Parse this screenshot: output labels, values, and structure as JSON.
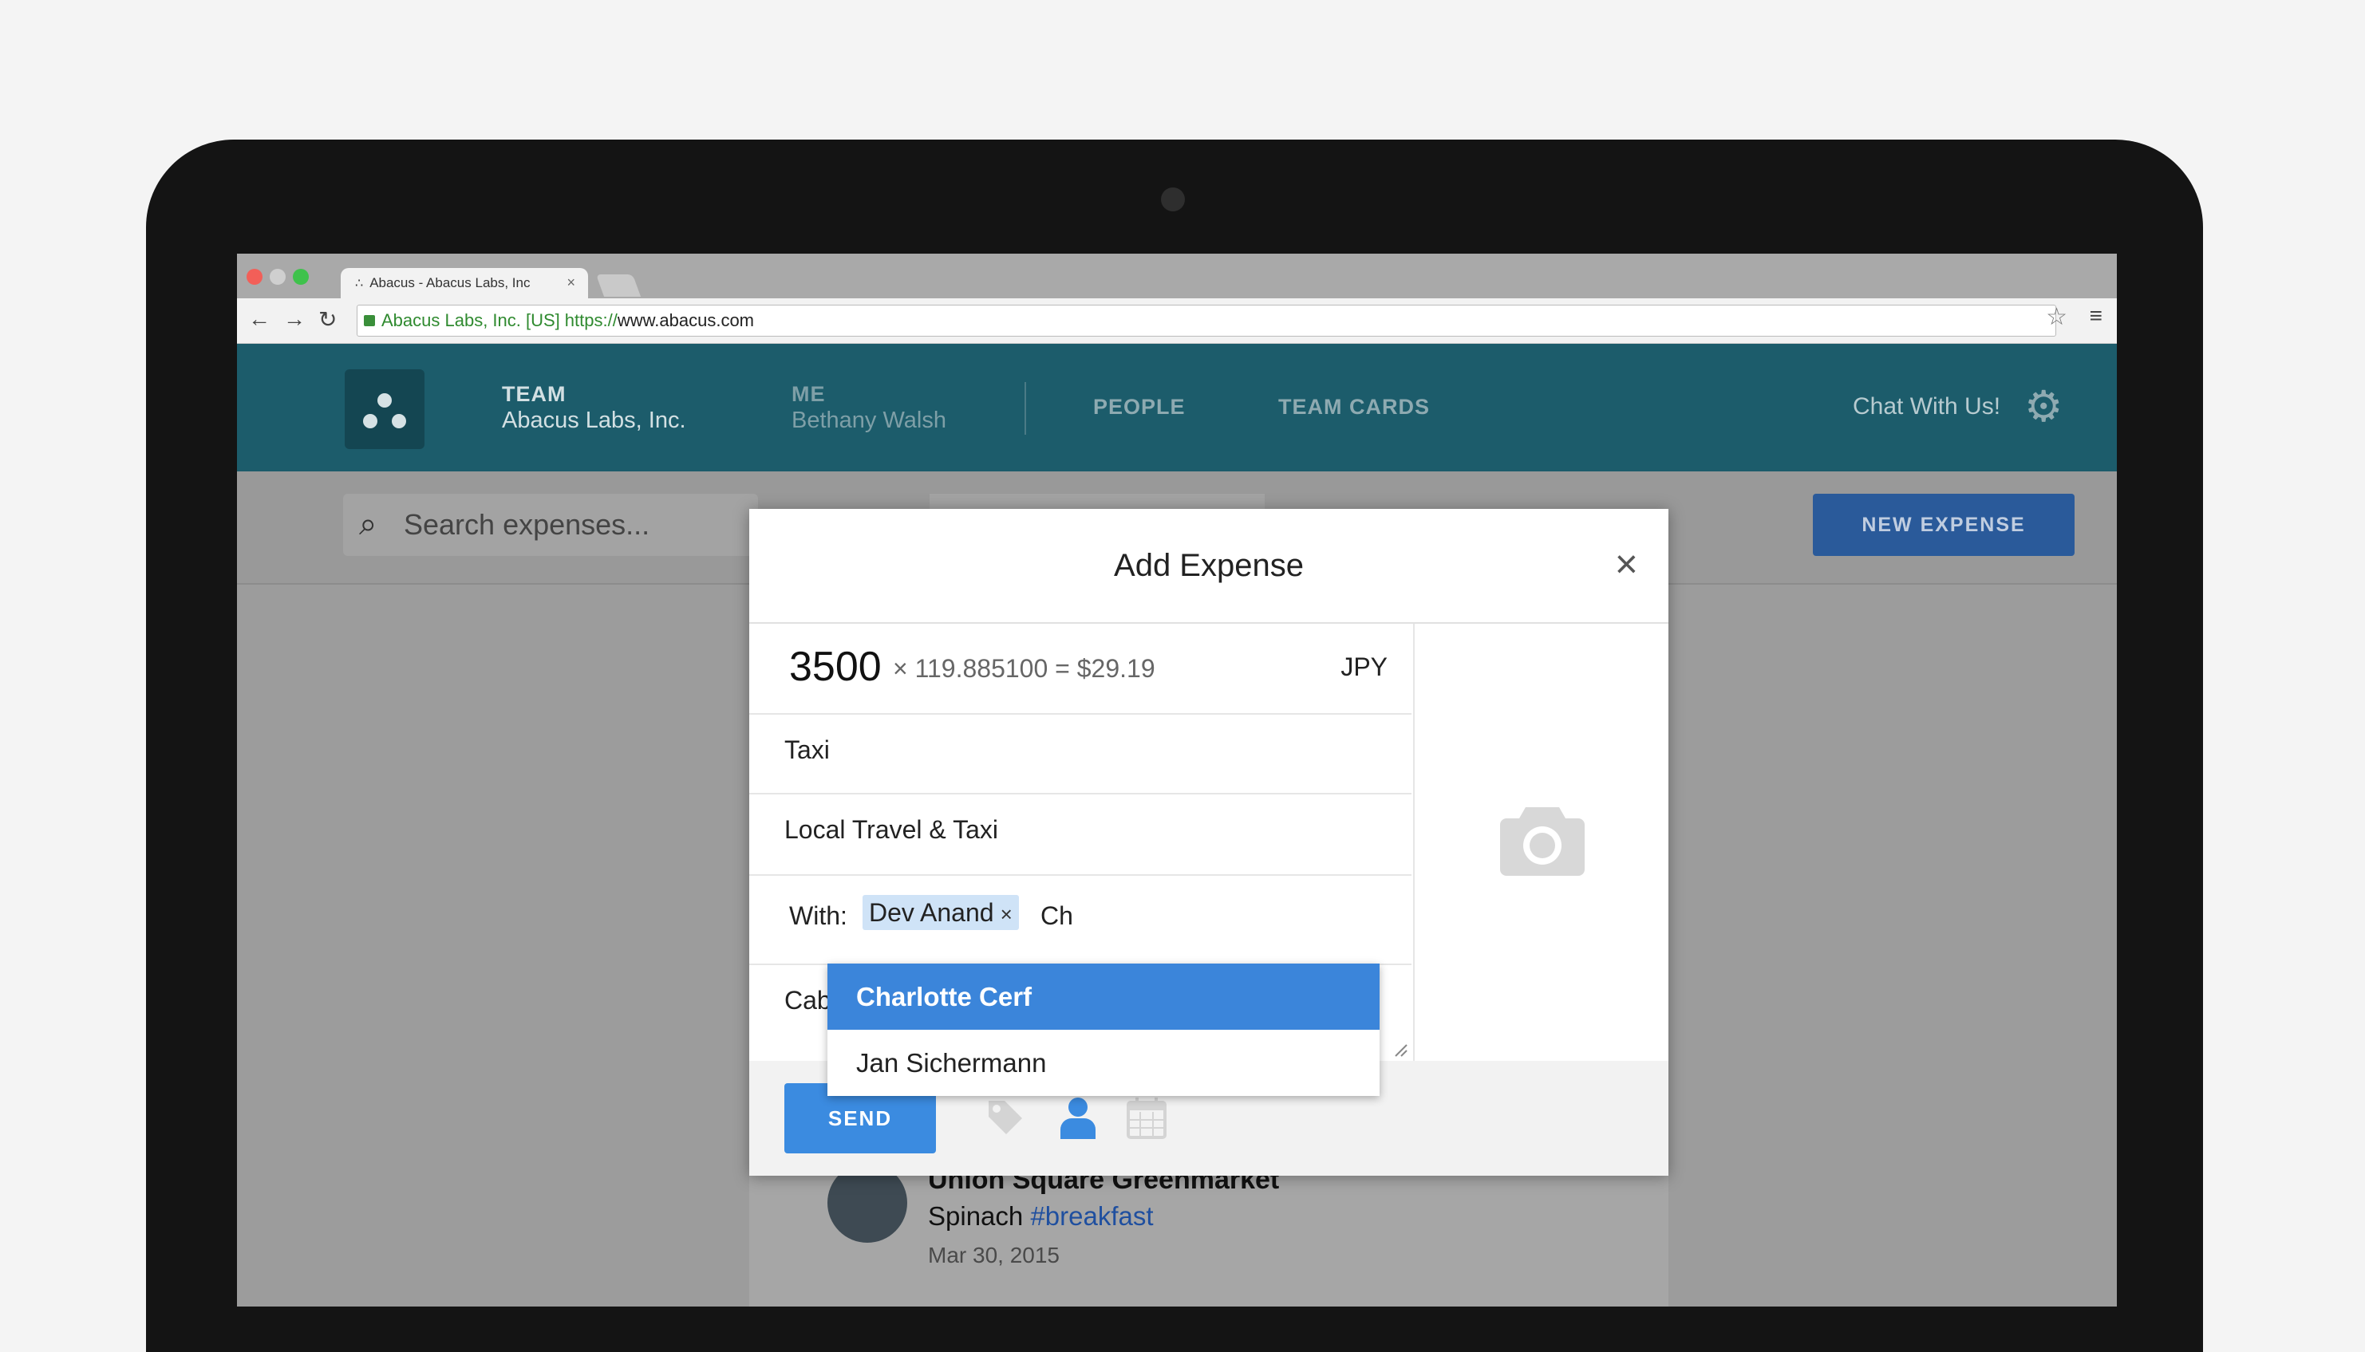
{
  "browser": {
    "tab_title": "Abacus - Abacus Labs, Inc",
    "tab_close": "×",
    "ev_label": "Abacus Labs, Inc. [US]",
    "url_scheme": "https://",
    "url_host": "www.abacus.com"
  },
  "header": {
    "team_label": "TEAM",
    "team_name": "Abacus Labs, Inc.",
    "me_label": "ME",
    "me_name": "Bethany Walsh",
    "nav_people": "PEOPLE",
    "nav_team_cards": "TEAM CARDS",
    "chat": "Chat With Us!",
    "gear_icon": "gear-icon"
  },
  "page": {
    "search_placeholder": "Search expenses...",
    "new_expense": "NEW EXPENSE",
    "expense_item": {
      "merchant": "Union Square Greenmarket",
      "desc_text": "Spinach ",
      "desc_tag": "#breakfast",
      "date": "Mar 30, 2015"
    }
  },
  "modal": {
    "title": "Add Expense",
    "close": "×",
    "amount": "3500",
    "conversion": "× 119.885100 = $29.19",
    "currency": "JPY",
    "merchant": "Taxi",
    "category": "Local Travel & Taxi",
    "with_label": "With:",
    "with_chip": "Dev Anand",
    "chip_remove": "×",
    "with_typed": "Ch",
    "notes": "Cab",
    "send": "SEND",
    "footer_icons": [
      "tag-icon",
      "person-icon",
      "calendar-icon"
    ]
  },
  "dropdown": {
    "items": [
      "Charlotte Cerf",
      "Jan Sichermann"
    ],
    "selected_index": 0
  },
  "colors": {
    "header_bg": "#1c5c6b",
    "primary_blue": "#3b8be0",
    "chip_bg": "#cfe3f7"
  }
}
